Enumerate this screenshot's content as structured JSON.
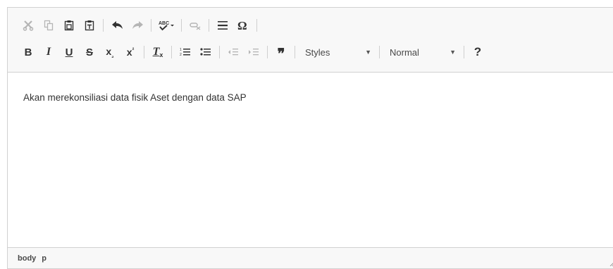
{
  "toolbar": {
    "row1": [
      {
        "name": "cut-icon",
        "enabled": false
      },
      {
        "name": "copy-icon",
        "enabled": false
      },
      {
        "name": "paste-icon",
        "enabled": true
      },
      {
        "name": "paste-text-icon",
        "enabled": true
      },
      {
        "name": "undo-icon",
        "enabled": true
      },
      {
        "name": "redo-icon",
        "enabled": false
      },
      {
        "name": "spellcheck-icon",
        "enabled": true
      },
      {
        "name": "remove-link-icon",
        "enabled": false
      },
      {
        "name": "horizontal-rule-icon",
        "enabled": true
      },
      {
        "name": "special-char-icon",
        "enabled": true
      }
    ],
    "bold_label": "B",
    "italic_label": "I",
    "underline_label": "U",
    "strike_label": "S",
    "subscript_label": "x",
    "superscript_label": "x",
    "remove_format_label": "T",
    "blockquote_label": "❞",
    "styles_label": "Styles",
    "format_label": "Normal",
    "help_label": "?"
  },
  "content": {
    "text": "Akan merekonsiliasi data fisik Aset dengan data SAP"
  },
  "footer": {
    "path": [
      "body",
      "p"
    ]
  },
  "colors": {
    "toolbar_bg": "#f8f8f8",
    "border": "#d1d1d1",
    "icon": "#333333",
    "icon_disabled": "#b5b5b5"
  }
}
